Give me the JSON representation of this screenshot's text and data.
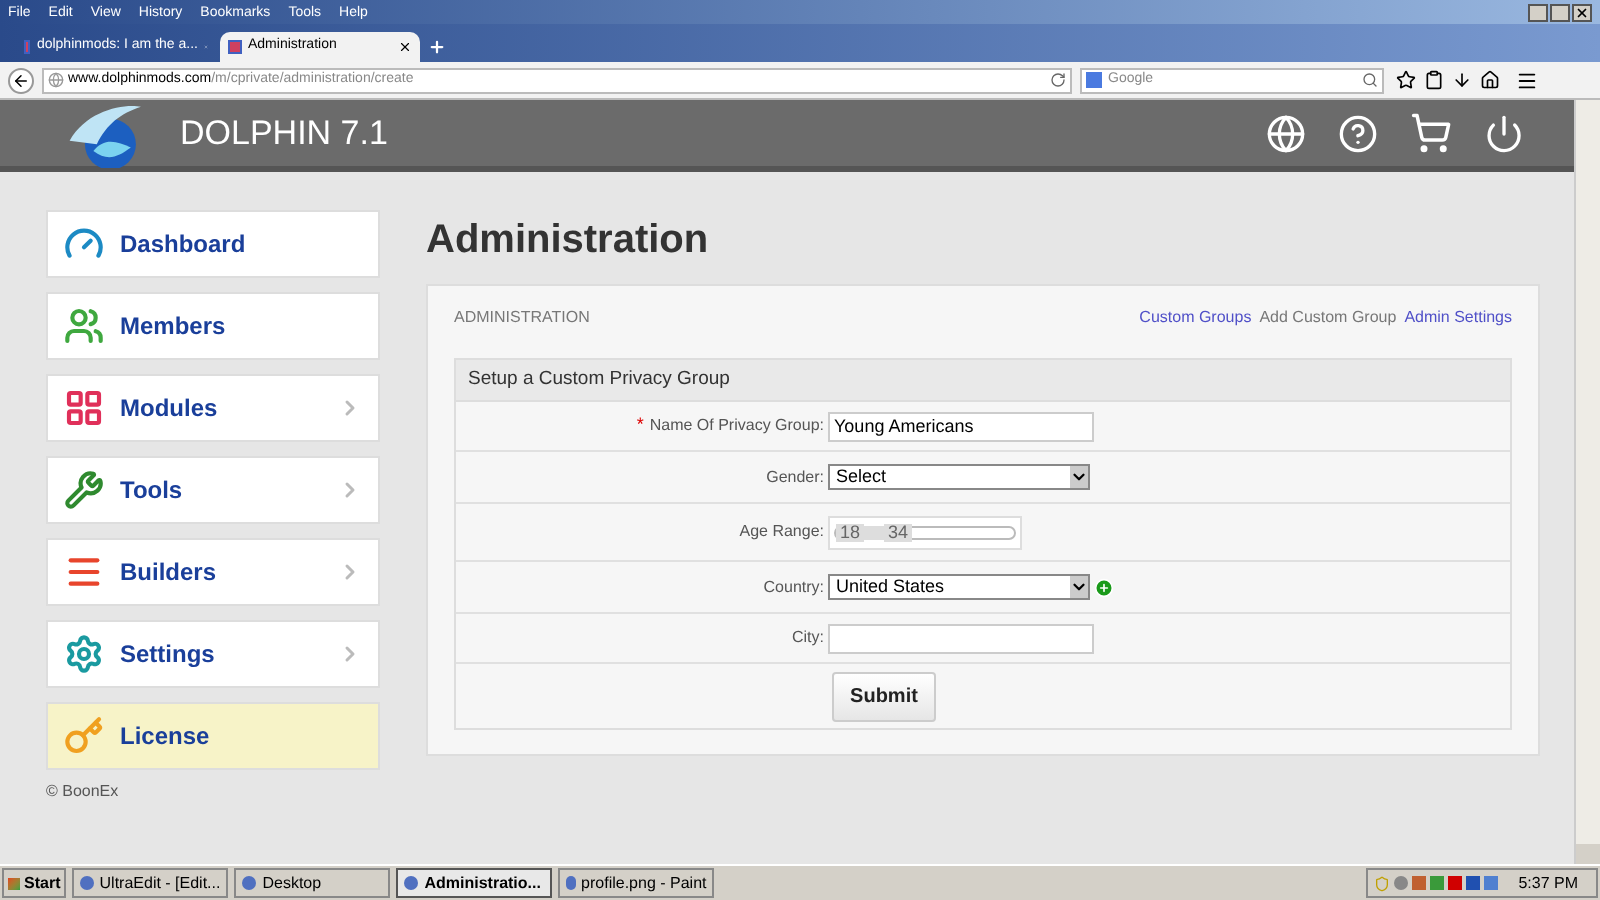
{
  "menu_bar": [
    "File",
    "Edit",
    "View",
    "History",
    "Bookmarks",
    "Tools",
    "Help"
  ],
  "tabs": [
    {
      "label": "dolphinmods: I am the a...",
      "selected": false
    },
    {
      "label": "Administration",
      "selected": true
    }
  ],
  "address_bar": {
    "host": "www.dolphinmods.com",
    "path": "/m/cprivate/administration/create"
  },
  "search": {
    "placeholder": "Google"
  },
  "header": {
    "title": "DOLPHIN 7.1"
  },
  "sidebar": {
    "items": [
      {
        "label": "Dashboard",
        "has_submenu": false,
        "selected": false
      },
      {
        "label": "Members",
        "has_submenu": false,
        "selected": false
      },
      {
        "label": "Modules",
        "has_submenu": true,
        "selected": false
      },
      {
        "label": "Tools",
        "has_submenu": true,
        "selected": false
      },
      {
        "label": "Builders",
        "has_submenu": true,
        "selected": false
      },
      {
        "label": "Settings",
        "has_submenu": true,
        "selected": false
      },
      {
        "label": "License",
        "has_submenu": false,
        "selected": true
      }
    ],
    "footer": "© BoonEx"
  },
  "page": {
    "title": "Administration",
    "breadcrumb": "ADMINISTRATION",
    "links": [
      {
        "label": "Custom Groups",
        "kind": "link"
      },
      {
        "label": "Add Custom Group",
        "kind": "current"
      },
      {
        "label": "Admin Settings",
        "kind": "link"
      }
    ],
    "form": {
      "title": "Setup a Custom Privacy Group",
      "fields": [
        {
          "label": "Name Of Privacy Group:",
          "kind": "text",
          "required_mark": "*",
          "value": "Young Americans"
        },
        {
          "label": "Gender:",
          "kind": "select",
          "value": "Select"
        },
        {
          "label": "Age Range:",
          "kind": "range",
          "from": "18",
          "to": "34"
        },
        {
          "label": "Country:",
          "kind": "select_add",
          "value": "United States"
        },
        {
          "label": "City:",
          "kind": "text"
        }
      ],
      "submit": "Submit"
    }
  },
  "taskbar": {
    "start": "Start",
    "items": [
      {
        "label": "UltraEdit - [Edit...",
        "selected": false
      },
      {
        "label": "Desktop",
        "selected": false
      },
      {
        "label": "Administratio...",
        "selected": true
      },
      {
        "label": "profile.png - Paint",
        "selected": false
      }
    ],
    "clock": "5:37 PM"
  }
}
